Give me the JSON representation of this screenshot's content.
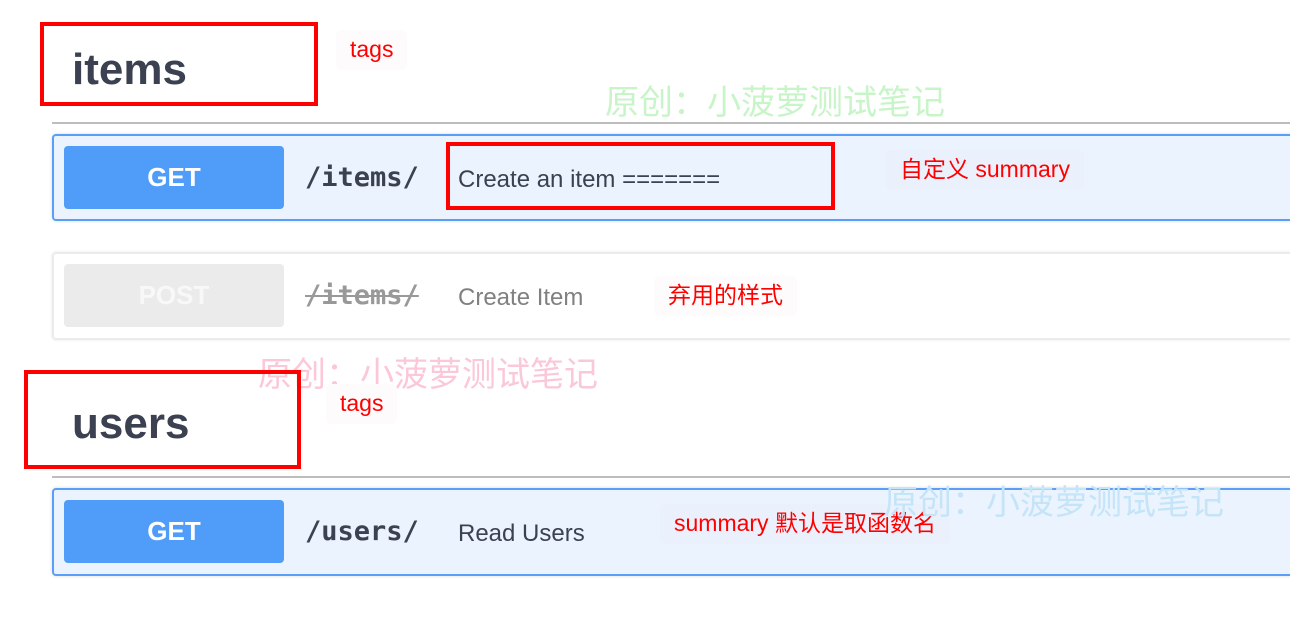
{
  "sections": [
    {
      "tag": "items",
      "annotation": "tags"
    },
    {
      "tag": "users",
      "annotation": "tags"
    }
  ],
  "operations": [
    {
      "method": "GET",
      "path": "/items/",
      "summary": "Create an item =======",
      "annotation": "自定义 summary",
      "deprecated": false
    },
    {
      "method": "POST",
      "path": "/items/",
      "summary": "Create Item",
      "annotation": "弃用的样式",
      "deprecated": true
    },
    {
      "method": "GET",
      "path": "/users/",
      "summary": "Read Users",
      "annotation": "summary 默认是取函数名",
      "deprecated": false
    }
  ],
  "watermarks": [
    {
      "text": "原创：小菠萝测试笔记",
      "color": "#c8f5c8"
    },
    {
      "text": "原创：小菠萝测试笔记",
      "color": "#fbc8d8"
    },
    {
      "text": "原创：小菠萝测试笔记",
      "color": "#c4e4f8"
    }
  ],
  "colors": {
    "get": "#4f9cf9",
    "annotation": "#ff0000",
    "deprecated": "#ebebeb"
  }
}
